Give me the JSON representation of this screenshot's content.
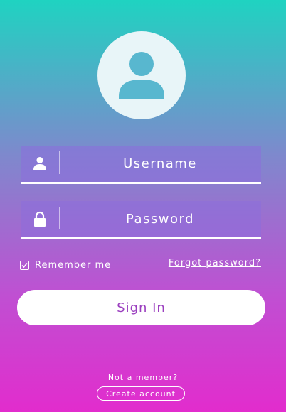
{
  "avatar": {
    "icon": "user-icon"
  },
  "username": {
    "placeholder": "Username",
    "value": "",
    "icon": "user-icon"
  },
  "password": {
    "placeholder": "Password",
    "value": "",
    "icon": "lock-icon"
  },
  "remember": {
    "label": "Remember me",
    "checked": true
  },
  "forgot_link": "Forgot password?",
  "signin_label": "Sign In",
  "footer": {
    "prompt": "Not a member?",
    "create_label": "Create account"
  },
  "colors": {
    "gradient_top": "#1fd3c1",
    "gradient_bottom": "#e22ccd",
    "avatar_icon": "#58b7cf",
    "signin_text": "#9b3fbf"
  }
}
